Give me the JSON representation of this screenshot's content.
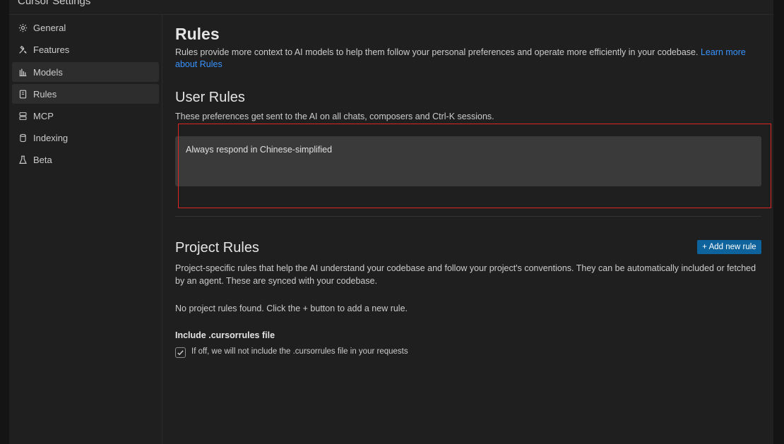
{
  "window": {
    "title": "Cursor Settings"
  },
  "sidebar": {
    "items": [
      {
        "label": "General",
        "icon": "gear-icon"
      },
      {
        "label": "Features",
        "icon": "tools-icon"
      },
      {
        "label": "Models",
        "icon": "bar-chart-icon"
      },
      {
        "label": "Rules",
        "icon": "document-icon"
      },
      {
        "label": "MCP",
        "icon": "server-icon"
      },
      {
        "label": "Indexing",
        "icon": "database-icon"
      },
      {
        "label": "Beta",
        "icon": "flask-icon"
      }
    ]
  },
  "main": {
    "title": "Rules",
    "description": "Rules provide more context to AI models to help them follow your personal preferences and operate more efficiently in your codebase. ",
    "learn_more": "Learn more about Rules",
    "user_rules": {
      "heading": "User Rules",
      "description": "These preferences get sent to the AI on all chats, composers and Ctrl-K sessions.",
      "value": "Always respond in Chinese-simplified"
    },
    "project_rules": {
      "heading": "Project Rules",
      "add_button": "+ Add new rule",
      "description": "Project-specific rules that help the AI understand your codebase and follow your project's conventions. They can be automatically included or fetched by an agent. These are synced with your codebase.",
      "empty_text": "No project rules found. Click the + button to add a new rule."
    },
    "cursorrules": {
      "label": "Include .cursorrules file",
      "checked": true,
      "description": "If off, we will not include the .cursorrules file in your requests"
    }
  },
  "colors": {
    "accent": "#0e639c",
    "link": "#3794ff",
    "highlight": "#e02424"
  }
}
